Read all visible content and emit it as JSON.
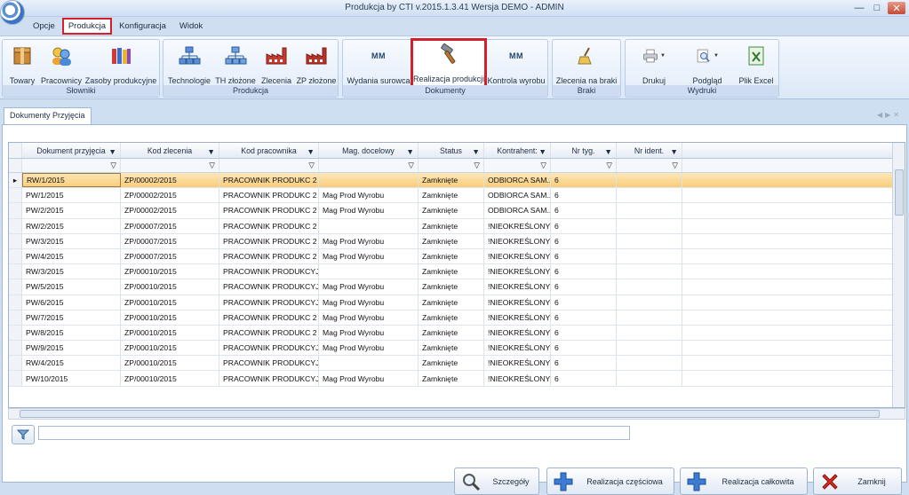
{
  "window": {
    "title": "Produkcja by CTI v.2015.1.3.41 Wersja DEMO - ADMIN"
  },
  "menu": {
    "tabs": [
      "Opcje",
      "Produkcja",
      "Konfiguracja",
      "Widok"
    ]
  },
  "ribbon": {
    "groups": {
      "slowniki": {
        "label": "Słowniki",
        "buttons": [
          "Towary",
          "Pracownicy",
          "Zasoby produkcyjne"
        ]
      },
      "produkcja": {
        "label": "Produkcja",
        "buttons": [
          "Technologie",
          "TH złożone",
          "Zlecenia",
          "ZP złożone"
        ]
      },
      "dokumenty": {
        "label": "Dokumenty",
        "buttons": [
          "Wydania surowca",
          "Realizacja produkcji",
          "Kontrola wyrobu"
        ]
      },
      "braki": {
        "label": "Braki",
        "buttons": [
          "Zlecenia na braki"
        ]
      },
      "wydruki": {
        "label": "Wydruki",
        "buttons": [
          "Drukuj",
          "Podgląd",
          "Plik Excel"
        ]
      }
    },
    "mm_label": "MM"
  },
  "doc_tab": "Dokumenty Przyjęcia",
  "grid": {
    "columns": [
      "Dokument przyjęcia",
      "Kod zlecenia",
      "Kod pracownika",
      "Mag. docelowy",
      "Status",
      "Kontrahent:",
      "Nr tyg.",
      "Nr ident."
    ],
    "rows": [
      [
        "RW/1/2015",
        "ZP/00002/2015",
        "PRACOWNIK PRODUKC 2",
        "",
        "Zamknięte",
        "ODBIORCA SAM...",
        "6",
        ""
      ],
      [
        "PW/1/2015",
        "ZP/00002/2015",
        "PRACOWNIK PRODUKC 2",
        "Mag Prod Wyrobu",
        "Zamknięte",
        "ODBIORCA SAM...",
        "6",
        ""
      ],
      [
        "PW/2/2015",
        "ZP/00002/2015",
        "PRACOWNIK PRODUKC 2",
        "Mag Prod Wyrobu",
        "Zamknięte",
        "ODBIORCA SAM...",
        "6",
        ""
      ],
      [
        "RW/2/2015",
        "ZP/00007/2015",
        "PRACOWNIK PRODUKC 2",
        "",
        "Zamknięte",
        "!NIEOKREŚLONY!",
        "6",
        ""
      ],
      [
        "PW/3/2015",
        "ZP/00007/2015",
        "PRACOWNIK PRODUKC 2",
        "Mag Prod Wyrobu",
        "Zamknięte",
        "!NIEOKREŚLONY!",
        "6",
        ""
      ],
      [
        "PW/4/2015",
        "ZP/00007/2015",
        "PRACOWNIK PRODUKC 2",
        "Mag Prod Wyrobu",
        "Zamknięte",
        "!NIEOKREŚLONY!",
        "6",
        ""
      ],
      [
        "RW/3/2015",
        "ZP/00010/2015",
        "PRACOWNIK PRODUKCYJN",
        "",
        "Zamknięte",
        "!NIEOKREŚLONY!",
        "6",
        ""
      ],
      [
        "PW/5/2015",
        "ZP/00010/2015",
        "PRACOWNIK PRODUKCYJN",
        "Mag Prod Wyrobu",
        "Zamknięte",
        "!NIEOKREŚLONY!",
        "6",
        ""
      ],
      [
        "PW/6/2015",
        "ZP/00010/2015",
        "PRACOWNIK PRODUKCYJN",
        "Mag Prod Wyrobu",
        "Zamknięte",
        "!NIEOKREŚLONY!",
        "6",
        ""
      ],
      [
        "PW/7/2015",
        "ZP/00010/2015",
        "PRACOWNIK PRODUKC 2",
        "Mag Prod Wyrobu",
        "Zamknięte",
        "!NIEOKREŚLONY!",
        "6",
        ""
      ],
      [
        "PW/8/2015",
        "ZP/00010/2015",
        "PRACOWNIK PRODUKC 2",
        "Mag Prod Wyrobu",
        "Zamknięte",
        "!NIEOKREŚLONY!",
        "6",
        ""
      ],
      [
        "PW/9/2015",
        "ZP/00010/2015",
        "PRACOWNIK PRODUKCYJN",
        "Mag Prod Wyrobu",
        "Zamknięte",
        "!NIEOKREŚLONY!",
        "6",
        ""
      ],
      [
        "RW/4/2015",
        "ZP/00010/2015",
        "PRACOWNIK PRODUKCYJN",
        "",
        "Zamknięte",
        "!NIEOKREŚLONY!",
        "6",
        ""
      ],
      [
        "PW/10/2015",
        "ZP/00010/2015",
        "PRACOWNIK PRODUKCYJN",
        "Mag Prod Wyrobu",
        "Zamknięte",
        "!NIEOKREŚLONY!",
        "6",
        ""
      ]
    ],
    "selected_row": 0
  },
  "filter": {
    "value": ""
  },
  "footer_buttons": {
    "details": "Szczegóły",
    "partial": "Realizacja częściowa",
    "full": "Realizacja całkowita",
    "close": "Zamknij"
  },
  "colors": {
    "highlight": "#d2212a",
    "selected_row": "#f8cd79"
  }
}
